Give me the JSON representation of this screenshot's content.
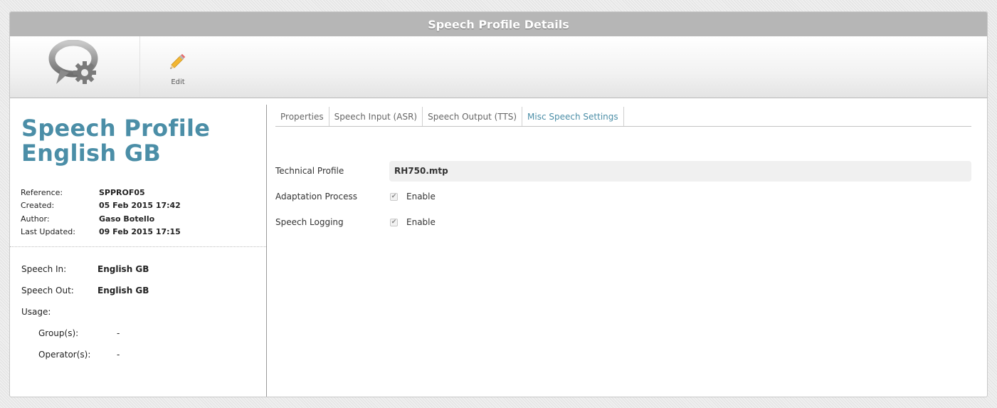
{
  "window": {
    "title": "Speech Profile Details"
  },
  "toolbar": {
    "logo_icon": "speech-bubble-gear-icon",
    "edit_icon": "pencil-icon",
    "edit_label": "Edit"
  },
  "profile": {
    "title_line1": "Speech Profile",
    "title_line2": "English GB",
    "meta": [
      {
        "key": "Reference:",
        "value": "SPPROF05"
      },
      {
        "key": "Created:",
        "value": "05 Feb 2015 17:42"
      },
      {
        "key": "Author:",
        "value": "Gaso Botello"
      },
      {
        "key": "Last Updated:",
        "value": "09 Feb 2015 17:15"
      }
    ],
    "speech_in_label": "Speech In:",
    "speech_in_value": "English GB",
    "speech_out_label": "Speech Out:",
    "speech_out_value": "English GB",
    "usage_label": "Usage:",
    "groups_label": "Group(s):",
    "groups_value": "-",
    "operators_label": "Operator(s):",
    "operators_value": "-"
  },
  "tabs": [
    {
      "label": "Properties"
    },
    {
      "label": "Speech Input (ASR)"
    },
    {
      "label": "Speech Output (TTS)"
    },
    {
      "label": "Misc Speech Settings",
      "active": true
    }
  ],
  "form": {
    "technical_profile_label": "Technical Profile",
    "technical_profile_value": "RH750.mtp",
    "adaptation_label": "Adaptation Process",
    "adaptation_checked": true,
    "adaptation_option": "Enable",
    "logging_label": "Speech Logging",
    "logging_checked": true,
    "logging_option": "Enable"
  },
  "colors": {
    "accent": "#4b8ea7",
    "titlebar": "#b6b6b6"
  }
}
